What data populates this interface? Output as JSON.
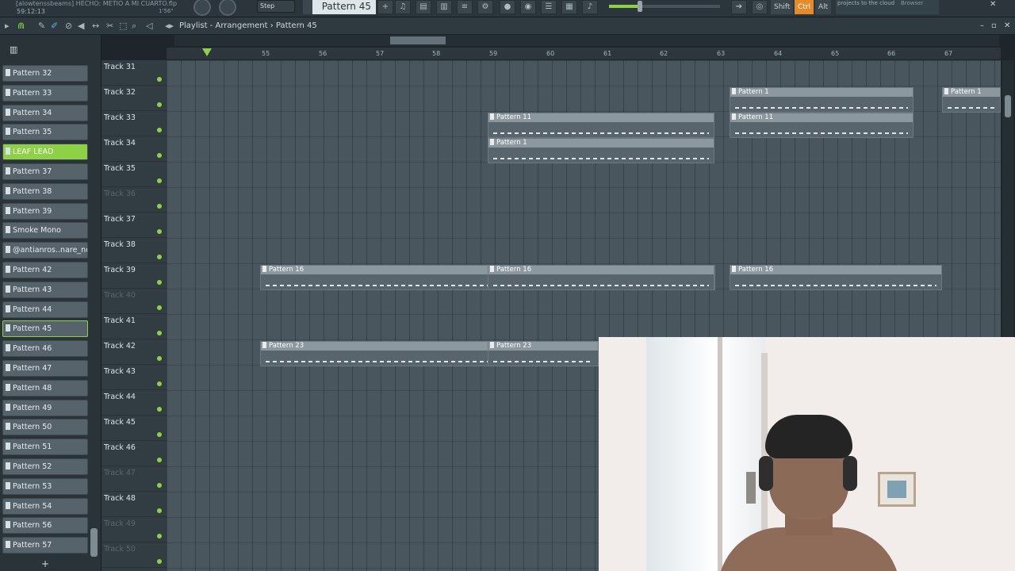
{
  "toolbar": {
    "song_title": "[alowtenssbeams] HECHO: METIO A MI CUARTO.flp",
    "time": "59:12:13",
    "song_length": "1'56\"",
    "snap_mode": "Step",
    "pattern_selector": "Pattern 45",
    "modifiers": [
      "Shift",
      "Ctrl",
      "Alt"
    ],
    "hint": "projects to the cloud",
    "browser_label": "Browser"
  },
  "playlist": {
    "breadcrumb": "Playlist - Arrangement  ›  Pattern 45",
    "bar_numbers": [
      "55",
      "56",
      "57",
      "58",
      "59",
      "60",
      "61",
      "62",
      "63",
      "64",
      "65",
      "66",
      "67"
    ]
  },
  "picker": {
    "items": [
      {
        "label": "Pattern 32",
        "state": "normal"
      },
      {
        "label": "Pattern 33",
        "state": "normal"
      },
      {
        "label": "Pattern 34",
        "state": "normal"
      },
      {
        "label": "Pattern 35",
        "state": "normal"
      },
      {
        "label": "LEAF LEAD",
        "state": "selected"
      },
      {
        "label": "Pattern 37",
        "state": "normal"
      },
      {
        "label": "Pattern 38",
        "state": "normal"
      },
      {
        "label": "Pattern 39",
        "state": "normal"
      },
      {
        "label": "Smoke Mono",
        "state": "normal"
      },
      {
        "label": "@antianros..nare_nono",
        "state": "normal"
      },
      {
        "label": "Pattern 42",
        "state": "normal"
      },
      {
        "label": "Pattern 43",
        "state": "normal"
      },
      {
        "label": "Pattern 44",
        "state": "normal"
      },
      {
        "label": "Pattern 45",
        "state": "highlighted"
      },
      {
        "label": "Pattern 46",
        "state": "normal"
      },
      {
        "label": "Pattern 47",
        "state": "normal"
      },
      {
        "label": "Pattern 48",
        "state": "normal"
      },
      {
        "label": "Pattern 49",
        "state": "normal"
      },
      {
        "label": "Pattern 50",
        "state": "normal"
      },
      {
        "label": "Pattern 51",
        "state": "normal"
      },
      {
        "label": "Pattern 52",
        "state": "normal"
      },
      {
        "label": "Pattern 53",
        "state": "normal"
      },
      {
        "label": "Pattern 54",
        "state": "normal"
      },
      {
        "label": "Pattern 56",
        "state": "normal"
      },
      {
        "label": "Pattern 57",
        "state": "normal"
      }
    ],
    "add_label": "+"
  },
  "tracks": [
    {
      "name": "Track 31",
      "faded": false
    },
    {
      "name": "Track 32",
      "faded": false
    },
    {
      "name": "Track 33",
      "faded": false
    },
    {
      "name": "Track 34",
      "faded": false
    },
    {
      "name": "Track 35",
      "faded": false
    },
    {
      "name": "Track 36",
      "faded": true
    },
    {
      "name": "Track 37",
      "faded": false
    },
    {
      "name": "Track 38",
      "faded": false
    },
    {
      "name": "Track 39",
      "faded": false
    },
    {
      "name": "Track 40",
      "faded": true
    },
    {
      "name": "Track 41",
      "faded": false
    },
    {
      "name": "Track 42",
      "faded": false
    },
    {
      "name": "Track 43",
      "faded": false
    },
    {
      "name": "Track 44",
      "faded": false
    },
    {
      "name": "Track 45",
      "faded": false
    },
    {
      "name": "Track 46",
      "faded": false
    },
    {
      "name": "Track 47",
      "faded": true
    },
    {
      "name": "Track 48",
      "faded": false
    },
    {
      "name": "Track 49",
      "faded": true
    },
    {
      "name": "Track 50",
      "faded": true
    }
  ],
  "clips": [
    {
      "label": "Pattern 1"
    },
    {
      "label": "Pattern 1"
    },
    {
      "label": "Pattern 11"
    },
    {
      "label": "Pattern 11"
    },
    {
      "label": "Pattern 1"
    },
    {
      "label": "Pattern 16"
    },
    {
      "label": "Pattern 16"
    },
    {
      "label": "Pattern 16"
    },
    {
      "label": "Pattern 23"
    },
    {
      "label": "Pattern 23"
    }
  ]
}
